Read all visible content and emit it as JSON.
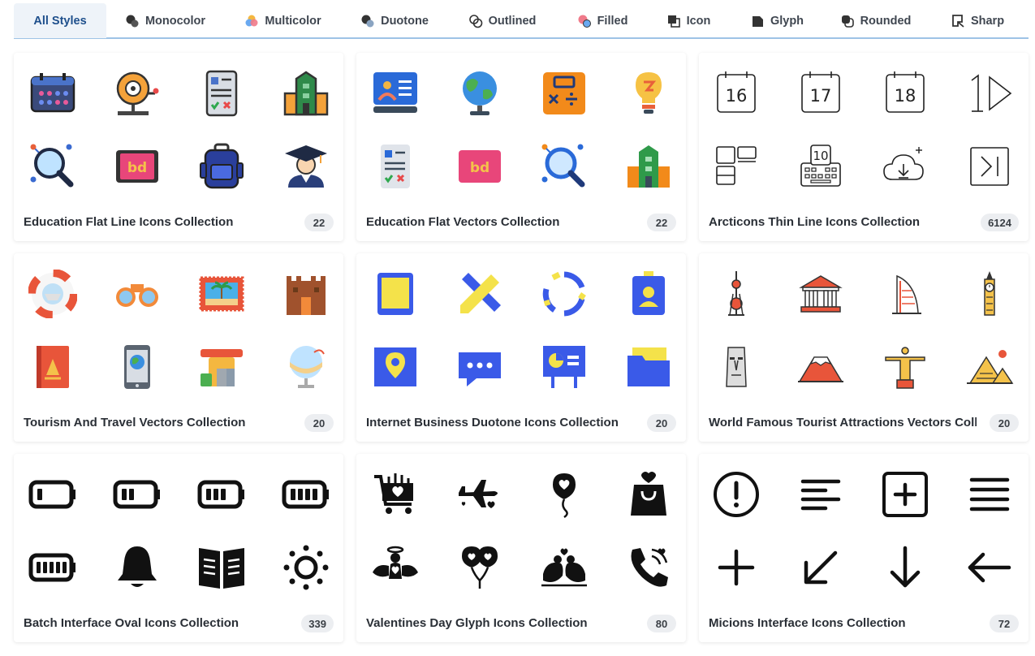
{
  "tabs": [
    {
      "label": "All Styles",
      "icon": "",
      "active": true
    },
    {
      "label": "Monocolor",
      "icon": "monocolor-icon"
    },
    {
      "label": "Multicolor",
      "icon": "multicolor-icon"
    },
    {
      "label": "Duotone",
      "icon": "duotone-icon"
    },
    {
      "label": "Outlined",
      "icon": "outlined-icon"
    },
    {
      "label": "Filled",
      "icon": "filled-icon"
    },
    {
      "label": "Icon",
      "icon": "icon-style-icon"
    },
    {
      "label": "Glyph",
      "icon": "glyph-icon"
    },
    {
      "label": "Rounded",
      "icon": "rounded-icon"
    },
    {
      "label": "Sharp",
      "icon": "sharp-icon"
    }
  ],
  "collections": [
    {
      "title": "Education Flat Line Icons Collection",
      "count": "22",
      "icons": [
        "calendar-icon",
        "school-bell-icon",
        "checklist-icon",
        "school-building-icon",
        "magnifier-icon",
        "tablet-icon",
        "backpack-icon",
        "graduate-icon"
      ]
    },
    {
      "title": "Education Flat Vectors Collection",
      "count": "22",
      "icons": [
        "id-card-icon",
        "globe-icon",
        "calculator-icon",
        "light-bulb-icon",
        "checklist-icon",
        "tablet-icon",
        "magnifier-icon",
        "school-building-icon"
      ]
    },
    {
      "title": "Arcticons Thin Line Icons Collection",
      "count": "6124",
      "icons": [
        "calendar-16-icon",
        "calendar-17-icon",
        "calendar-18-icon",
        "play-one-icon",
        "widgets-icon",
        "keyboard-icon",
        "cloud-download-icon",
        "skip-next-icon"
      ],
      "icon_text": [
        "16",
        "17",
        "18"
      ]
    },
    {
      "title": "Tourism And Travel Vectors Collection",
      "count": "20",
      "icons": [
        "lifebuoy-icon",
        "binoculars-icon",
        "stamp-icon",
        "castle-icon",
        "guidebook-icon",
        "smartphone-map-icon",
        "luggage-icon",
        "globe-stand-icon"
      ]
    },
    {
      "title": "Internet Business Duotone Icons Collection",
      "count": "20",
      "icons": [
        "tablet-icon",
        "tools-icon",
        "cycle-icon",
        "badge-icon",
        "map-pin-icon",
        "chat-icon",
        "presentation-icon",
        "folder-icon"
      ]
    },
    {
      "title": "World Famous Tourist Attractions Vectors Collection",
      "count": "20",
      "icons": [
        "tv-tower-icon",
        "parthenon-icon",
        "burj-al-arab-icon",
        "big-ben-icon",
        "moai-icon",
        "mount-fuji-icon",
        "christ-redeemer-icon",
        "pyramids-icon"
      ]
    },
    {
      "title": "Batch Interface Oval Icons Collection",
      "count": "339",
      "icons": [
        "battery-low-icon",
        "battery-half-icon",
        "battery-mid-icon",
        "battery-high-icon",
        "battery-full-icon",
        "bell-icon",
        "book-icon",
        "sun-icon"
      ]
    },
    {
      "title": "Valentines Day Glyph Icons Collection",
      "count": "80",
      "icons": [
        "shopping-cart-icon",
        "airplane-icon",
        "balloon-icon",
        "shopping-bag-icon",
        "cupid-icon",
        "balloons-icon",
        "love-birds-icon",
        "phone-call-icon"
      ]
    },
    {
      "title": "Micions Interface Icons Collection",
      "count": "72",
      "icons": [
        "alert-circle-icon",
        "align-left-icon",
        "add-square-icon",
        "menu-icon",
        "plus-icon",
        "arrow-down-left-icon",
        "arrow-down-icon",
        "arrow-left-icon"
      ]
    }
  ],
  "colors": {
    "accent": "#1e4f8c",
    "tab_active_bg": "#eef3f9",
    "tab_border": "#9ec3e6",
    "badge_bg": "#eceef1"
  }
}
